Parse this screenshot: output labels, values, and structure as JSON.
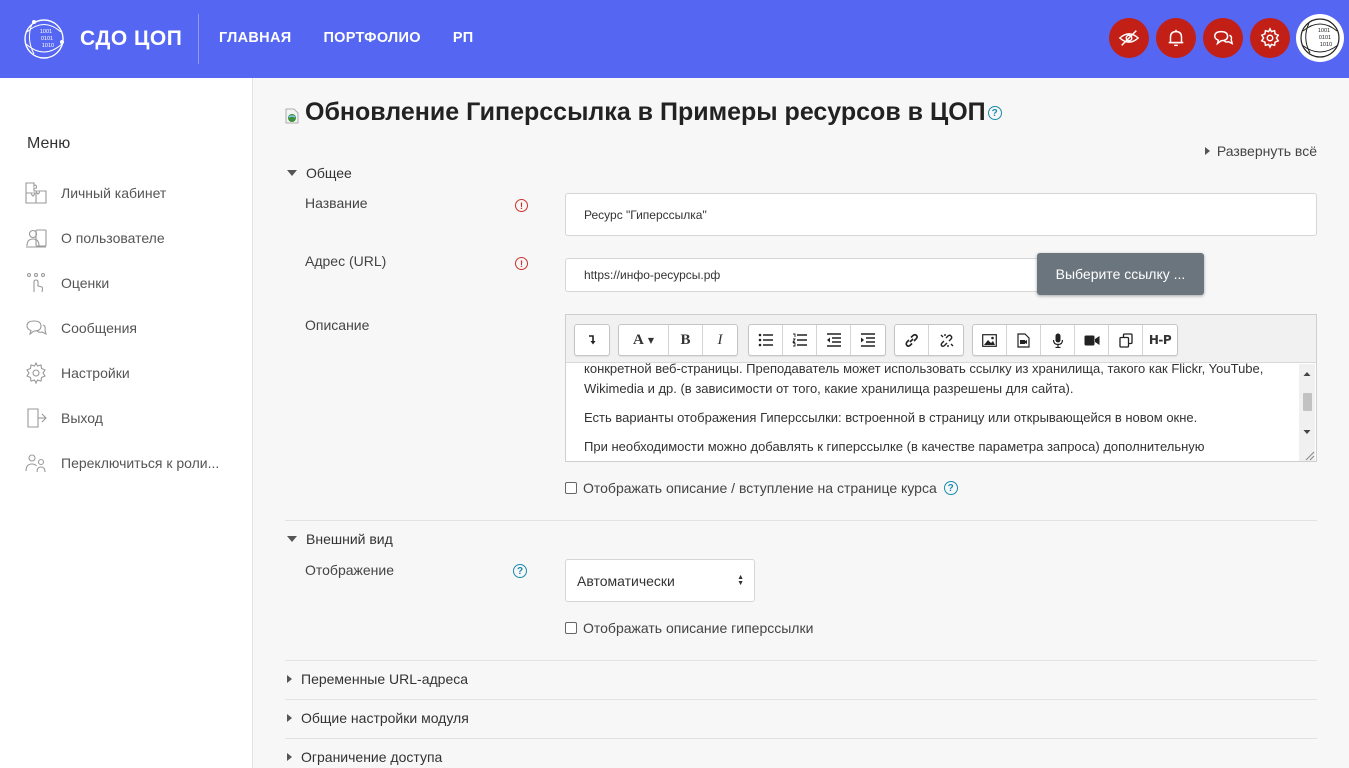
{
  "header": {
    "brand": "СДО ЦОП",
    "logo_text": "1001 0101 1010",
    "nav": [
      "ГЛАВНАЯ",
      "ПОРТФОЛИО",
      "РП"
    ],
    "icons": [
      "eye-off-icon",
      "bell-icon",
      "chat-icon",
      "gear-icon"
    ],
    "accent_color": "#5566f3",
    "icon_bg_color": "#c21f17"
  },
  "sidebar": {
    "title": "Меню",
    "items": [
      {
        "label": "Личный кабинет",
        "icon": "puzzle-icon"
      },
      {
        "label": "О пользователе",
        "icon": "user-profile-icon"
      },
      {
        "label": "Оценки",
        "icon": "grades-icon"
      },
      {
        "label": "Сообщения",
        "icon": "messages-icon"
      },
      {
        "label": "Настройки",
        "icon": "gear-icon"
      },
      {
        "label": "Выход",
        "icon": "logout-icon"
      },
      {
        "label": "Переключиться к роли...",
        "icon": "switch-role-icon"
      }
    ]
  },
  "main": {
    "title": "Обновление Гиперссылка в Примеры ресурсов в ЦОП",
    "expand_all": "Развернуть всё",
    "sections": {
      "general": {
        "title": "Общее",
        "name_label": "Название",
        "name_value": "Ресурс \"Гиперссылка\"",
        "url_label": "Адрес (URL)",
        "url_value": "https://инфо-ресурсы.рф",
        "choose_link": "Выберите ссылку ...",
        "description_label": "Описание",
        "description_paragraphs": [
          "конкретной веб-страницы. Преподаватель может использовать ссылку из хранилища, такого как Flickr, YouTube, Wikimedia и др. (в зависимости от того, какие хранилища разрешены для сайта).",
          "Есть варианты отображения Гиперссылки: встроенной в страницу или открывающейся в новом окне.",
          "При необходимости можно добавлять к гиперссылке (в качестве параметра запроса) дополнительную"
        ],
        "show_description": "Отображать описание / вступление на странице курса"
      },
      "appearance": {
        "title": "Внешний вид",
        "display_label": "Отображение",
        "display_value": "Автоматически",
        "show_url_description": "Отображать описание гиперссылки"
      },
      "url_variables": {
        "title": "Переменные URL-адреса"
      },
      "module_settings": {
        "title": "Общие настройки модуля"
      },
      "access_restriction": {
        "title": "Ограничение доступа"
      }
    }
  }
}
